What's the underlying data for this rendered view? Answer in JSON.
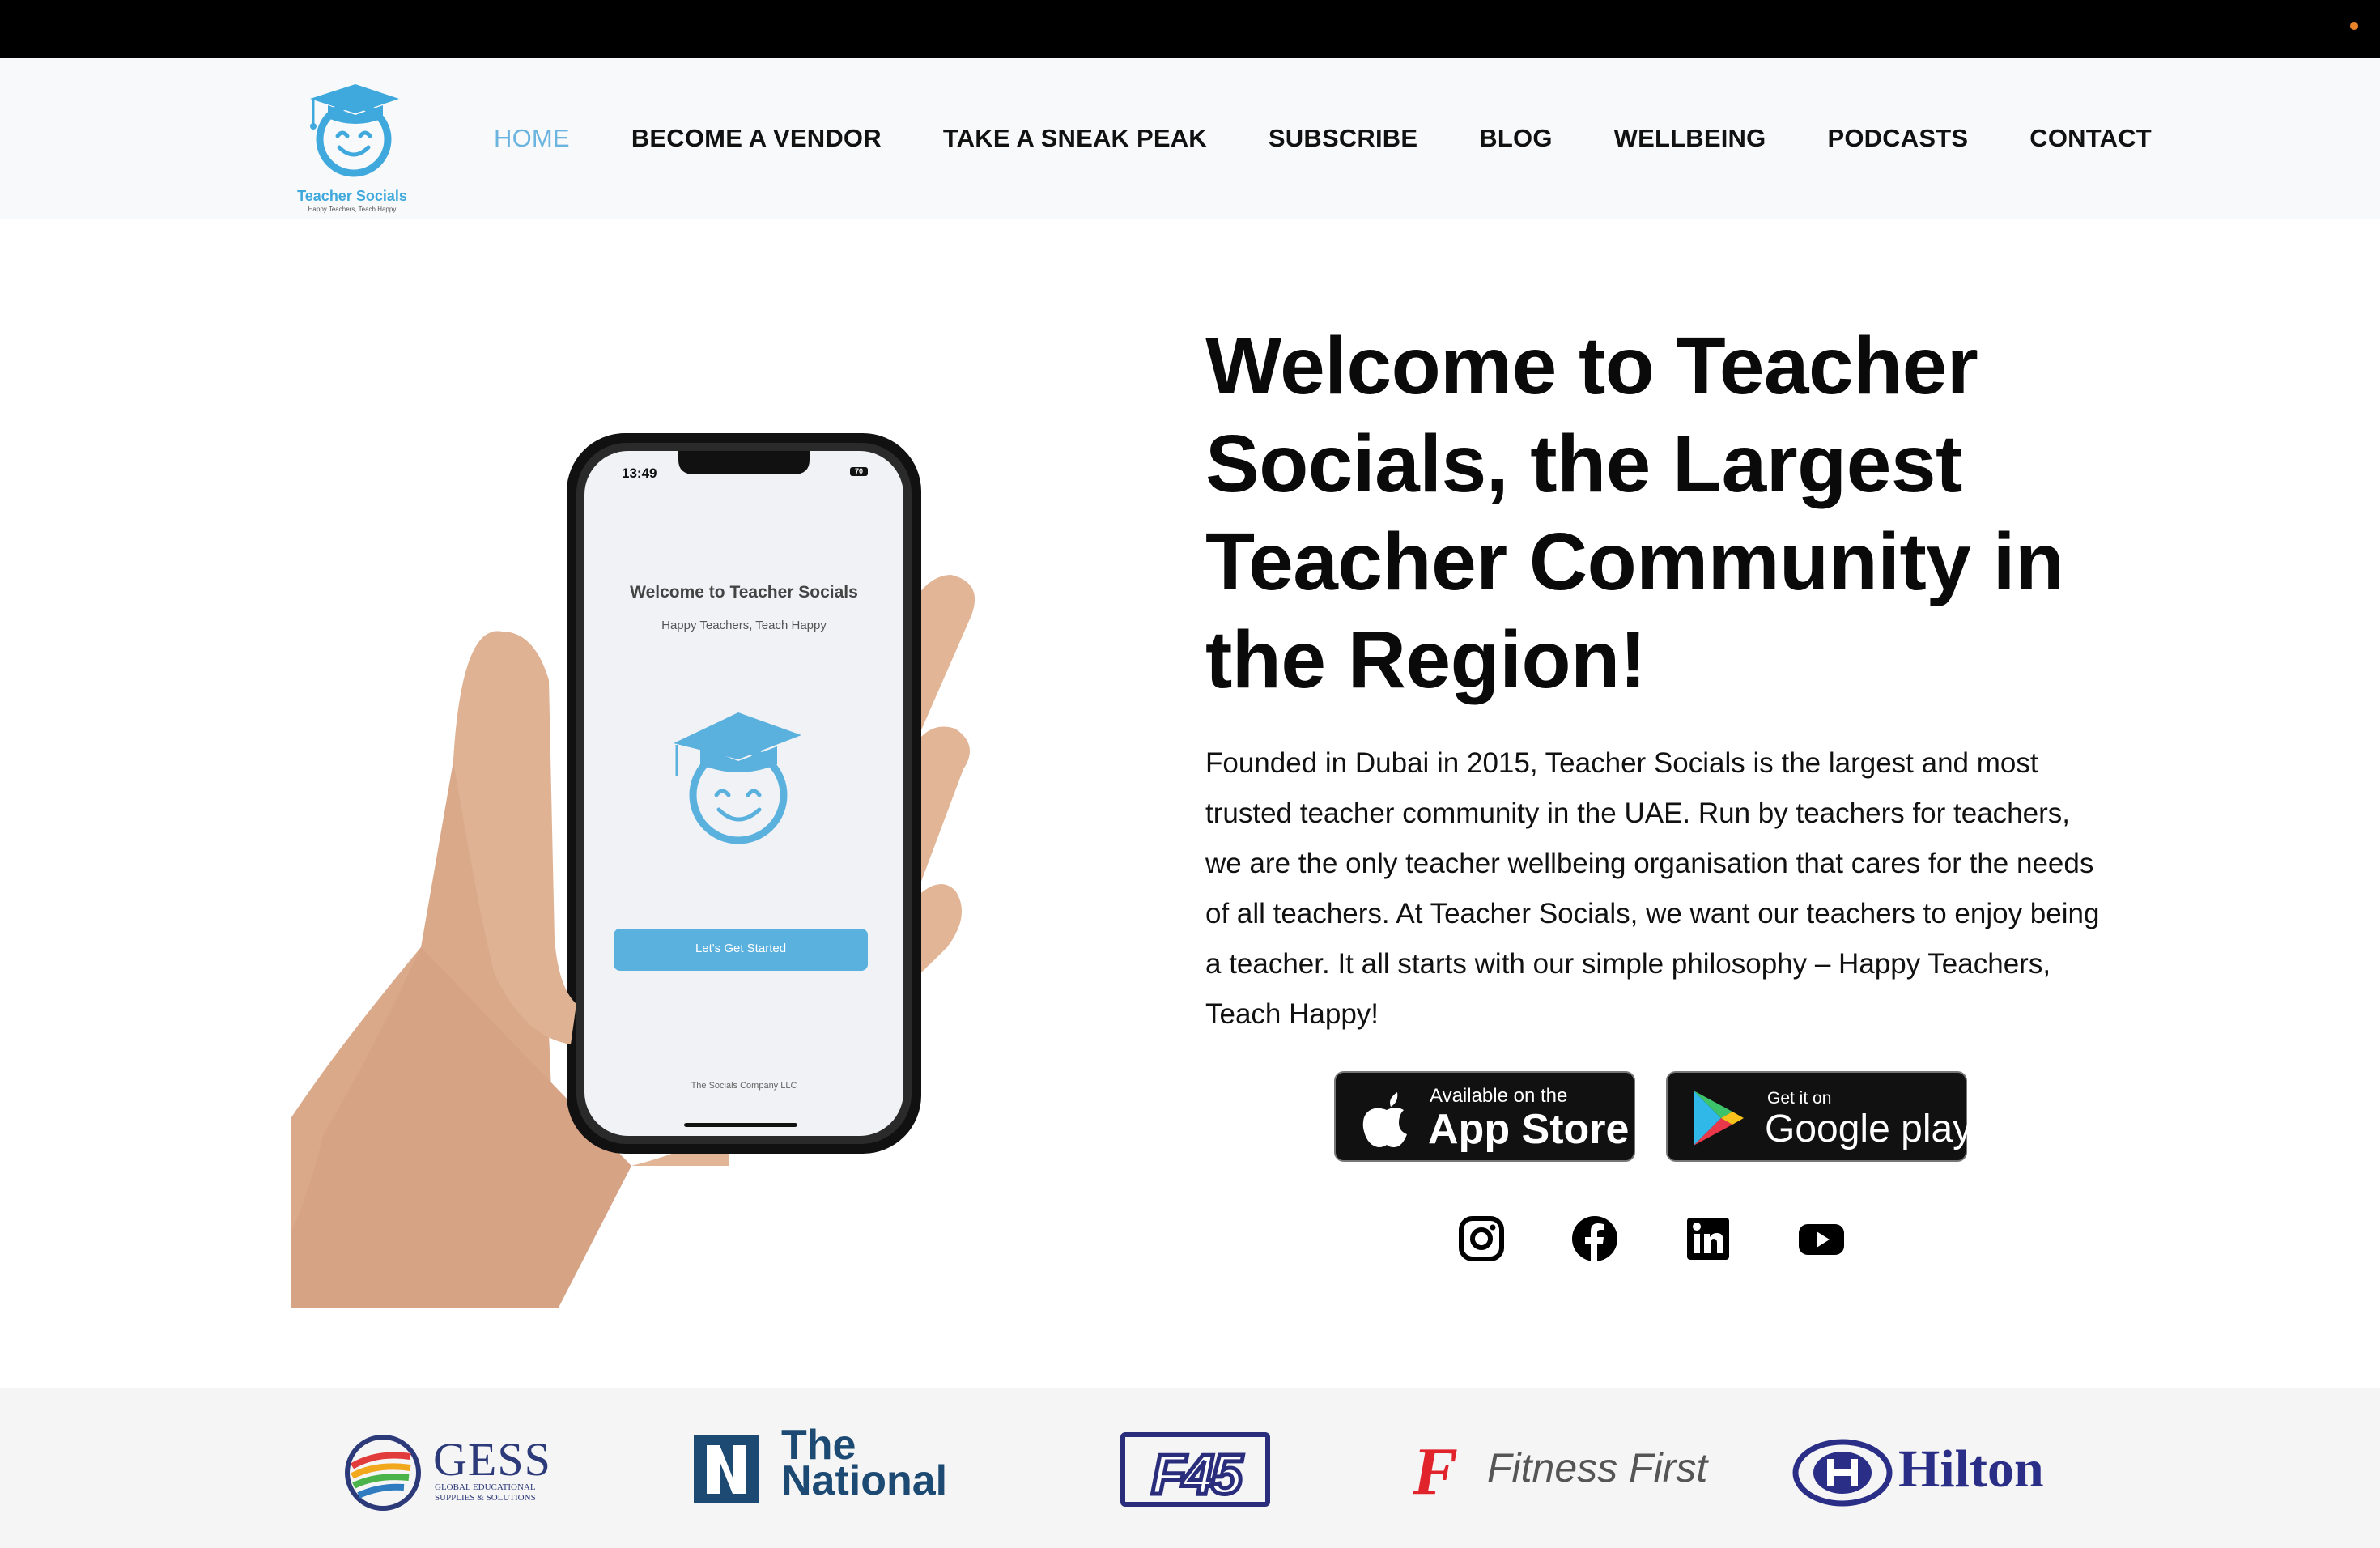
{
  "brand": {
    "name": "Teacher Socials",
    "tagline": "Happy Teachers, Teach Happy",
    "accent": "#3fa9dd"
  },
  "nav": {
    "items": [
      {
        "label": "HOME",
        "active": true
      },
      {
        "label": "BECOME A VENDOR",
        "active": false
      },
      {
        "label": "TAKE A SNEAK PEAK",
        "active": false
      },
      {
        "label": "SUBSCRIBE",
        "active": false
      },
      {
        "label": "BLOG",
        "active": false
      },
      {
        "label": "WELLBEING",
        "active": false
      },
      {
        "label": "PODCASTS",
        "active": false
      },
      {
        "label": "CONTACT",
        "active": false
      }
    ]
  },
  "phone": {
    "time": "13:49",
    "battery": "70",
    "welcome": "Welcome to Teacher Socials",
    "tagline": "Happy Teachers, Teach Happy",
    "cta": "Let's Get Started",
    "footer": "The Socials Company LLC"
  },
  "hero": {
    "headline": "Welcome to Teacher Socials, the Largest Teacher Community in the Region!",
    "intro": "Founded in Dubai in 2015, Teacher Socials is the largest and most trusted teacher community in the UAE. Run by teachers for teachers, we are the only teacher wellbeing organisation that cares for the needs of all teachers. At Teacher Socials, we want our teachers to enjoy being a teacher. It all starts with our simple philosophy – Happy Teachers, Teach Happy!"
  },
  "stores": {
    "apple": {
      "small": "Available on the",
      "big": "App Store"
    },
    "google": {
      "small": "Get it on",
      "big": "Google play"
    }
  },
  "socials": [
    "instagram-icon",
    "facebook-icon",
    "linkedin-icon",
    "youtube-icon"
  ],
  "partners": {
    "gess": {
      "name": "GESS",
      "sub": "GLOBAL EDUCATIONAL SUPPLIES & SOLUTIONS"
    },
    "national": {
      "line1": "The",
      "line2": "National"
    },
    "f45": {
      "name": "F45"
    },
    "fitnessfirst": {
      "name": "Fitness First"
    },
    "hilton": {
      "name": "Hilton"
    }
  }
}
